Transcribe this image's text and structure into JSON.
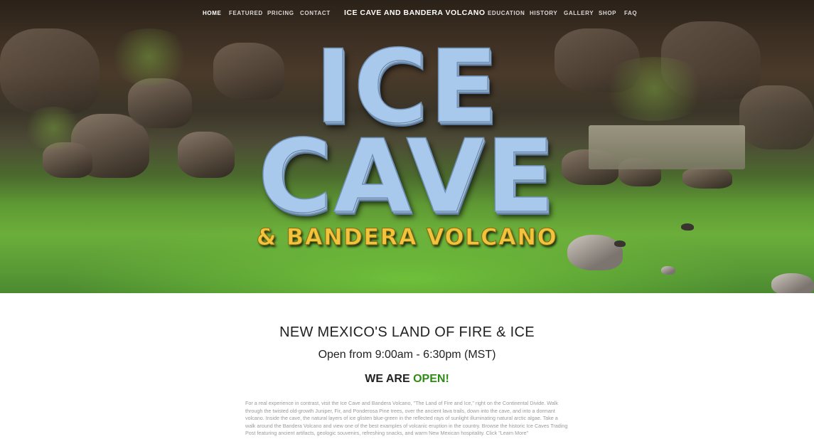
{
  "nav": {
    "left_items": [
      {
        "label": "HOME",
        "active": true
      },
      {
        "label": "FEATURED",
        "active": false
      },
      {
        "label": "PRICING",
        "active": false
      },
      {
        "label": "CONTACT",
        "active": false
      }
    ],
    "site_title": "ICE CAVE AND BANDERA VOLCANO",
    "right_items": [
      {
        "label": "EDUCATION",
        "active": false
      },
      {
        "label": "HISTORY",
        "active": false
      },
      {
        "label": "GALLERY",
        "active": false
      },
      {
        "label": "SHOP",
        "active": false
      },
      {
        "label": "FAQ",
        "active": false
      }
    ]
  },
  "hero": {
    "logo_line1": "ICE",
    "logo_line2": "CAVE",
    "logo_sub": "& BANDERA VOLCANO"
  },
  "main": {
    "headline": "NEW MEXICO'S LAND OF FIRE & ICE",
    "hours": "Open from 9:00am - 6:30pm (MST)",
    "status_prefix": "WE ARE ",
    "status_value": "OPEN!",
    "body": "For a real experience in contrast, visit the Ice Cave and Bandera Volcano, \"The Land of Fire and Ice,\" right on the Continental Divide. Walk through the twisted old-growth Juniper, Fir, and Ponderosa Pine trees, over the ancient lava trails, down into the cave, and into a dormant volcano. Inside the cave, the natural layers of ice glisten blue-green in the reflected rays of sunlight illuminating natural arctic algae. Take a walk around the Bandera Volcano and view one of the best examples of volcanic eruption in the country. Browse the historic Ice Caves Trading Post featuring ancient artifacts, geologic souvenirs, refreshing snacks, and warm New Mexican hospitality. Click \"Learn More\""
  },
  "colors": {
    "logo_blue": "#a9c9ec",
    "logo_gold": "#f2c43d",
    "open_green": "#2e8b14"
  }
}
